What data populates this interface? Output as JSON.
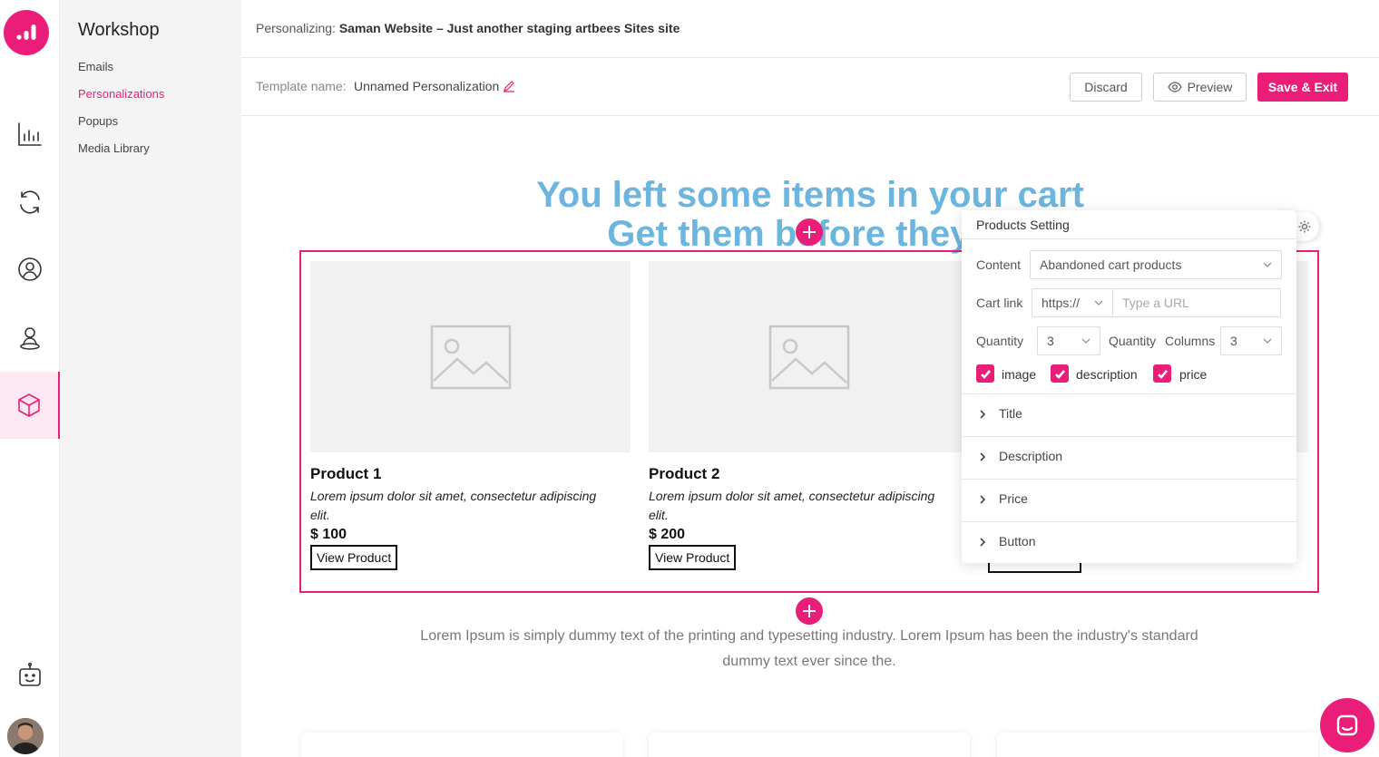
{
  "app": {
    "workspace": "Workshop"
  },
  "subnav": {
    "items": [
      "Emails",
      "Personalizations",
      "Popups",
      "Media Library"
    ]
  },
  "header": {
    "personalizing_label": "Personalizing:",
    "site_name": "Saman Website – Just another staging artbees Sites site"
  },
  "toolbar": {
    "template_label": "Template name:",
    "template_name": "Unnamed Personalization",
    "discard": "Discard",
    "preview": "Preview",
    "save": "Save & Exit"
  },
  "canvas": {
    "headline_line1": "You left some items in your cart",
    "headline_line2": "Get them before they're",
    "products": [
      {
        "title": "Product 1",
        "desc": "Lorem ipsum dolor sit amet, consectetur adipiscing elit.",
        "price": "$ 100",
        "button": "View Product"
      },
      {
        "title": "Product 2",
        "desc": "Lorem ipsum dolor sit amet, consectetur adipiscing elit.",
        "price": "$ 200",
        "button": "View Product"
      }
    ],
    "lorem": "Lorem Ipsum is simply dummy text of the printing and typesetting industry. Lorem Ipsum has been the industry's standard dummy text ever since the."
  },
  "panel": {
    "title": "Products Setting",
    "content_label": "Content",
    "content_value": "Abandoned cart products",
    "cart_link_label": "Cart link",
    "protocol": "https://",
    "url_placeholder": "Type a URL",
    "quantity_label": "Quantity",
    "quantity_value": "3",
    "quantity_label2": "Quantity",
    "columns_label": "Columns",
    "columns_value": "3",
    "checks": [
      "image",
      "description",
      "price"
    ],
    "sections": [
      "Title",
      "Description",
      "Price",
      "Button"
    ]
  },
  "colors": {
    "accent": "#ea1e79",
    "headline": "#6bb5de"
  }
}
